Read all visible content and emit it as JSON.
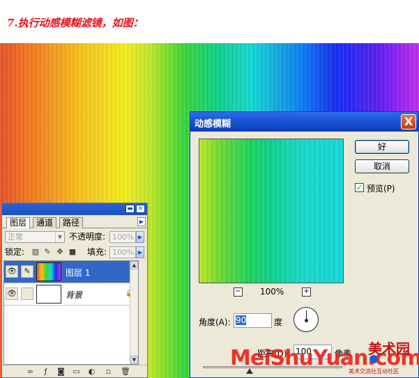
{
  "caption": "7.执行动感模糊滤镜，如图：",
  "layers_panel": {
    "tabs": [
      "图层",
      "通道",
      "路径"
    ],
    "blend_mode": "正常",
    "opacity_label": "不透明度:",
    "opacity_value": "100%",
    "lock_label": "锁定:",
    "fill_label": "填充:",
    "fill_value": "100%",
    "layers": [
      {
        "name": "图层 1",
        "selected": true
      },
      {
        "name": "背景",
        "selected": false,
        "locked": true
      }
    ]
  },
  "dialog": {
    "title": "动感模糊",
    "close_glyph": "X",
    "ok_label": "好",
    "cancel_label": "取消",
    "preview_label": "预览(P)",
    "preview_checked": true,
    "zoom_minus": "−",
    "zoom_plus": "+",
    "zoom_value": "100%",
    "angle_label": "角度(A):",
    "angle_value": "90",
    "angle_unit": "度",
    "distance_label": "距离(D):",
    "distance_value": "100",
    "distance_unit": "像素"
  },
  "watermark": {
    "main": "MeiShuYuan.com",
    "logo": "美术园",
    "sub": "美术交流社互动社区"
  },
  "colors": {
    "dialog_title": "#1a54d4",
    "selection": "#3168c7",
    "watermark": "#ef1a14"
  }
}
